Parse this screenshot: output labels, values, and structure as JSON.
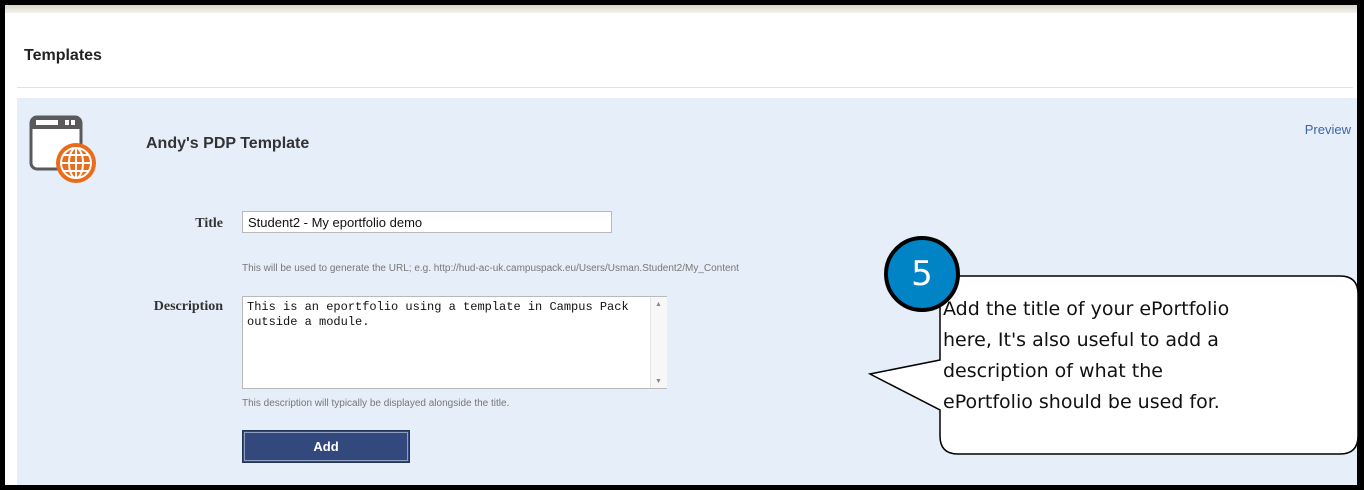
{
  "section": {
    "title": "Templates"
  },
  "template": {
    "name": "Andy's PDP Template",
    "preview_label": "Preview",
    "icon": "web-template-globe-icon"
  },
  "form": {
    "title_label": "Title",
    "title_value": "Student2 - My eportfolio demo",
    "title_hint": "This will be used to generate the URL; e.g. http://hud-ac-uk.campuspack.eu/Users/Usman.Student2/My_Content",
    "description_label": "Description",
    "description_value": "This is an eportfolio using a template in Campus Pack\noutside a module.",
    "description_hint": "This description will typically be displayed alongside the title.",
    "add_label": "Add"
  },
  "callout": {
    "step_number": "5",
    "lines": [
      "Add the title of your ePortfolio",
      "here, It's also useful to add a",
      "description of what the",
      "ePortfolio should be used for."
    ]
  },
  "colors": {
    "panel_bg": "#e6eef9",
    "button": "#33497e",
    "step_circle": "#0084c6",
    "link": "#3a67a8"
  }
}
